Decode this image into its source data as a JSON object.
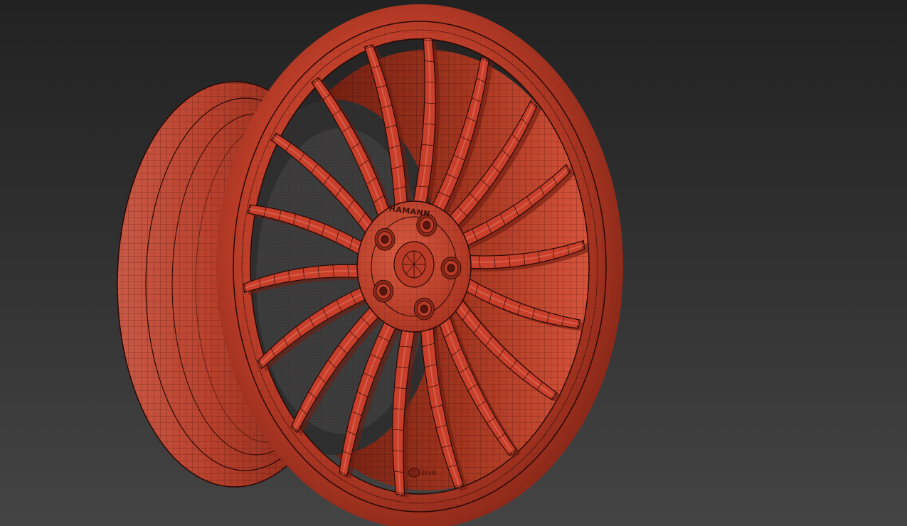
{
  "viewport": {
    "background_top": "#222222",
    "background_bottom": "#444444",
    "display_mode": "shaded-wireframe"
  },
  "model": {
    "name": "wheel-rim",
    "spoke_count": 18,
    "lug_count": 5,
    "shade_color": "#c8402c",
    "shade_light": "#e06a52",
    "shade_dark": "#6e1c10",
    "wire_color": "#2a0804",
    "hub_brand_text": "HAMANN",
    "rim_stamp_text": "20x9"
  }
}
